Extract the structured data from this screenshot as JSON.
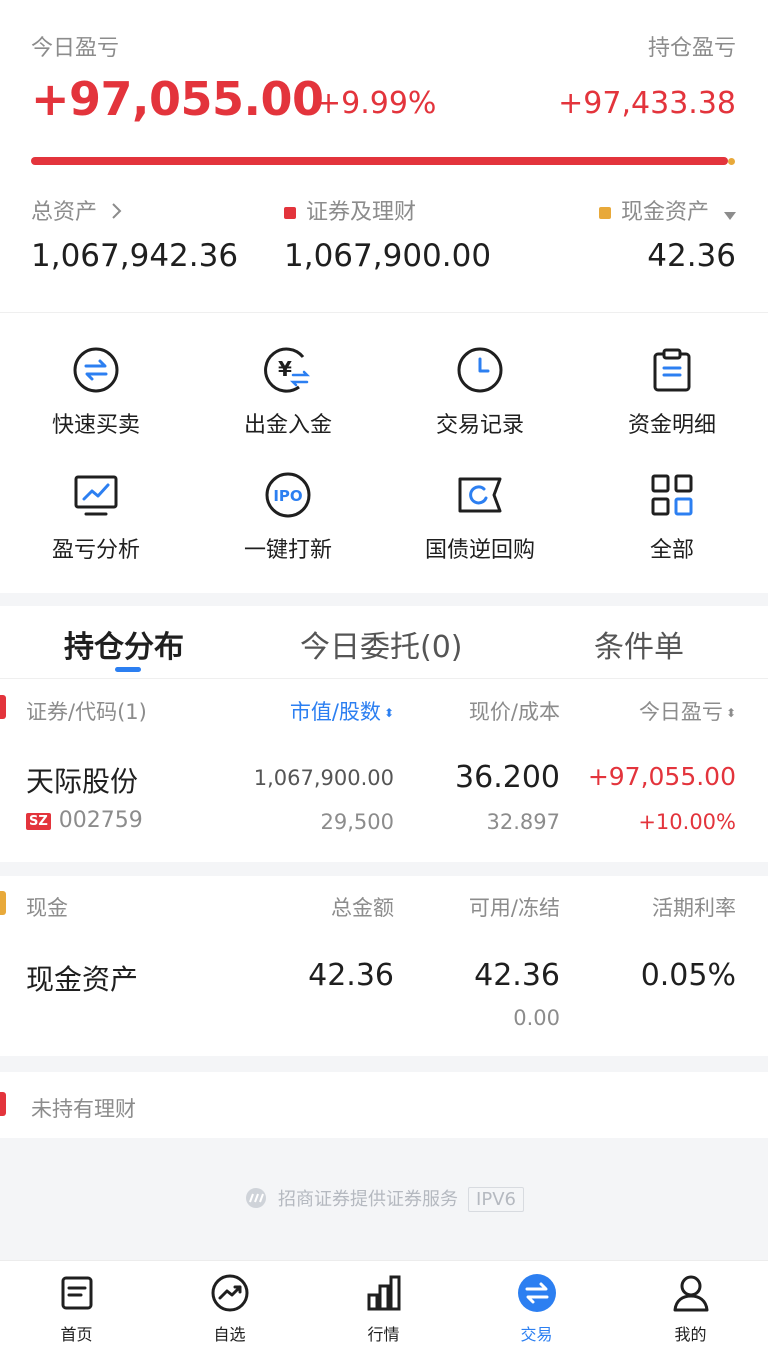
{
  "summary": {
    "today_pnl_label": "今日盈亏",
    "today_pnl_value": "+97,055.00",
    "today_pnl_pct": "+9.99%",
    "hold_pnl_label": "持仓盈亏",
    "hold_pnl_value": "+97,433.38",
    "progress_securities_fraction": 0.99,
    "total_assets_label": "总资产",
    "total_assets_value": "1,067,942.36",
    "securities_label": "证券及理财",
    "securities_value": "1,067,900.00",
    "cash_label": "现金资产",
    "cash_value": "42.36"
  },
  "colors": {
    "red": "#e3343c",
    "orange": "#e8a93a",
    "blue": "#2c7ff1"
  },
  "shortcuts": [
    {
      "label": "快速买卖",
      "icon": "quick-trade-icon"
    },
    {
      "label": "出金入金",
      "icon": "transfer-funds-icon"
    },
    {
      "label": "交易记录",
      "icon": "clock-icon"
    },
    {
      "label": "资金明细",
      "icon": "clipboard-icon"
    },
    {
      "label": "盈亏分析",
      "icon": "chart-monitor-icon"
    },
    {
      "label": "一键打新",
      "icon": "ipo-icon"
    },
    {
      "label": "国债逆回购",
      "icon": "bond-repo-icon"
    },
    {
      "label": "全部",
      "icon": "grid-icon"
    }
  ],
  "tabs": [
    {
      "label": "持仓分布",
      "active": true
    },
    {
      "label": "今日委托(0)",
      "active": false
    },
    {
      "label": "条件单",
      "active": false
    }
  ],
  "holdings": {
    "headers": {
      "security": "证券/代码(1)",
      "market_value": "市值/股数",
      "price_cost": "现价/成本",
      "today_pnl": "今日盈亏"
    },
    "rows": [
      {
        "name": "天际股份",
        "market": "SZ",
        "code": "002759",
        "market_value": "1,067,900.00",
        "shares": "29,500",
        "price": "36.200",
        "cost": "32.897",
        "pnl": "+97,055.00",
        "pnl_pct": "+10.00%"
      }
    ]
  },
  "cash": {
    "headers": {
      "name": "现金",
      "total": "总金额",
      "available_frozen": "可用/冻结",
      "rate": "活期利率"
    },
    "row": {
      "name": "现金资产",
      "total": "42.36",
      "available": "42.36",
      "frozen": "0.00",
      "rate": "0.05%"
    }
  },
  "wealth": {
    "label": "未持有理财"
  },
  "footer": {
    "note": "招商证券提供证券服务",
    "badge": "IPV6"
  },
  "nav": [
    {
      "label": "首页",
      "icon": "home-icon"
    },
    {
      "label": "自选",
      "icon": "watchlist-icon"
    },
    {
      "label": "行情",
      "icon": "market-icon"
    },
    {
      "label": "交易",
      "icon": "trade-icon",
      "active": true
    },
    {
      "label": "我的",
      "icon": "profile-icon"
    }
  ]
}
